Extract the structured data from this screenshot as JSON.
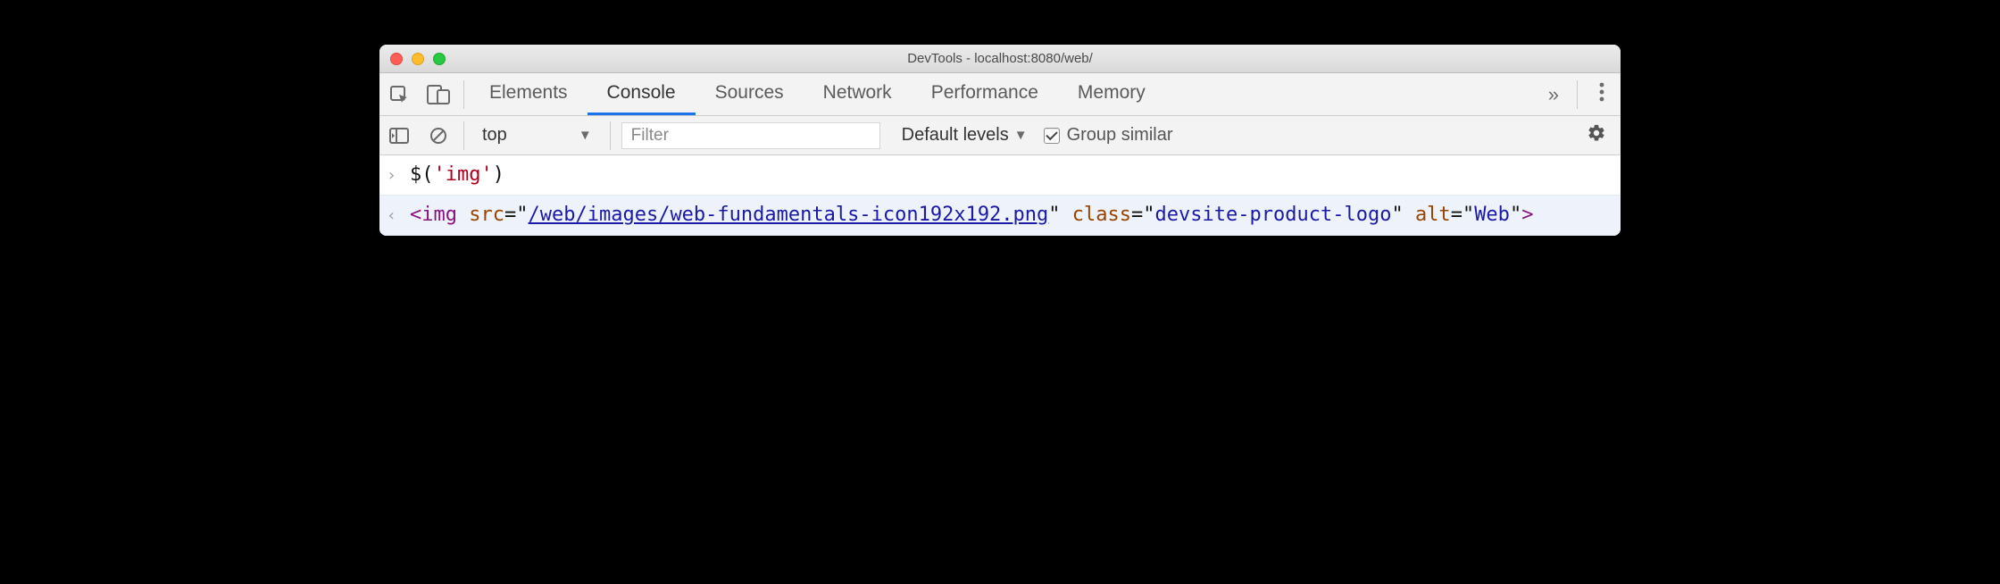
{
  "window": {
    "title": "DevTools - localhost:8080/web/"
  },
  "tabs": {
    "items": [
      "Elements",
      "Console",
      "Sources",
      "Network",
      "Performance",
      "Memory"
    ],
    "active_index": 1,
    "overflow_glyph": "»"
  },
  "toolbar": {
    "context": "top",
    "filter_placeholder": "Filter",
    "levels_label": "Default levels",
    "group_similar_label": "Group similar",
    "group_similar_checked": true
  },
  "console": {
    "input": {
      "fn": "$",
      "open": "(",
      "arg": "'img'",
      "close": ")"
    },
    "output": {
      "open": "<",
      "tag": "img",
      "space": " ",
      "src_name": "src",
      "eq": "=\"",
      "src_value": "/web/images/web-fundamentals-icon192x192.png",
      "q": "\"",
      "class_name": "class",
      "class_value": "devsite-product-logo",
      "alt_name": "alt",
      "alt_value": "Web",
      "close": ">"
    }
  }
}
